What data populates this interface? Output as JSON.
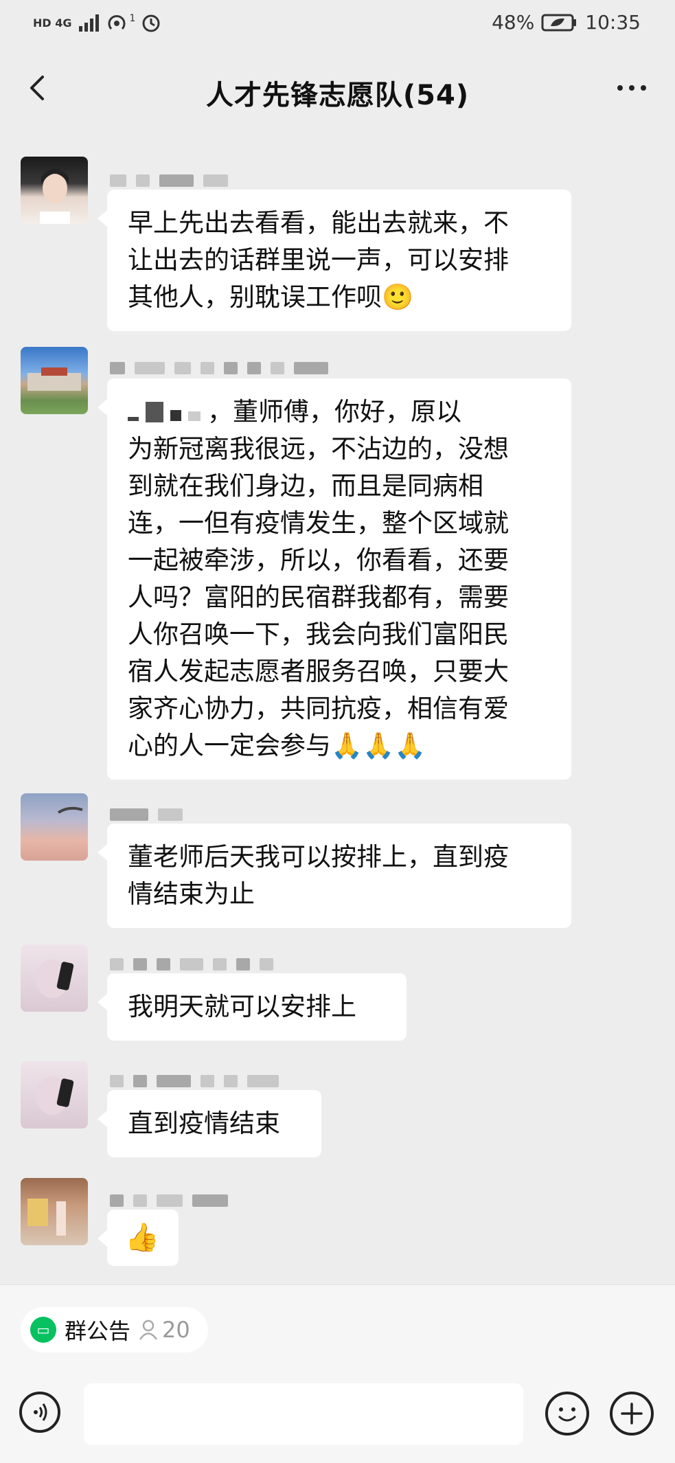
{
  "status_bar": {
    "network": "HD 4G",
    "hotspot_count": "1",
    "battery": "48%",
    "time": "10:35"
  },
  "header": {
    "title": "人才先锋志愿队(54)",
    "back_icon": "chevron-left-icon",
    "more_icon": "more-horizontal-icon"
  },
  "messages": [
    {
      "text_lines": [
        "早上先出去看看，能出去就来，不",
        "让出去的话群里说一声，可以安排",
        "其他人，别耽误工作呗🙂"
      ]
    },
    {
      "text_lines": [
        "，董师傅，你好，原以",
        "为新冠离我很远，不沾边的，没想",
        "到就在我们身边，而且是同病相",
        "连，一但有疫情发生，整个区域就",
        "一起被牵涉，所以，你看看，还要",
        "人吗？富阳的民宿群我都有，需要",
        "人你召唤一下，我会向我们富阳民",
        "宿人发起志愿者服务召唤，只要大",
        "家齐心协力，共同抗疫，相信有爱",
        "心的人一定会参与🙏🙏🙏"
      ]
    },
    {
      "text_lines": [
        "董老师后天我可以按排上，直到疫",
        "情结束为止"
      ]
    },
    {
      "text_lines": [
        "我明天就可以安排上"
      ]
    },
    {
      "text_lines": [
        "直到疫情结束"
      ]
    },
    {
      "text_lines": [
        "👍"
      ]
    }
  ],
  "bottom_bar": {
    "notice_label": "群公告",
    "member_count": "20",
    "voice_icon": "voice-icon",
    "emoji_icon": "emoji-icon",
    "plus_icon": "plus-icon"
  },
  "colors": {
    "background": "#ededed",
    "bubble": "#ffffff",
    "accent": "#07c160"
  }
}
